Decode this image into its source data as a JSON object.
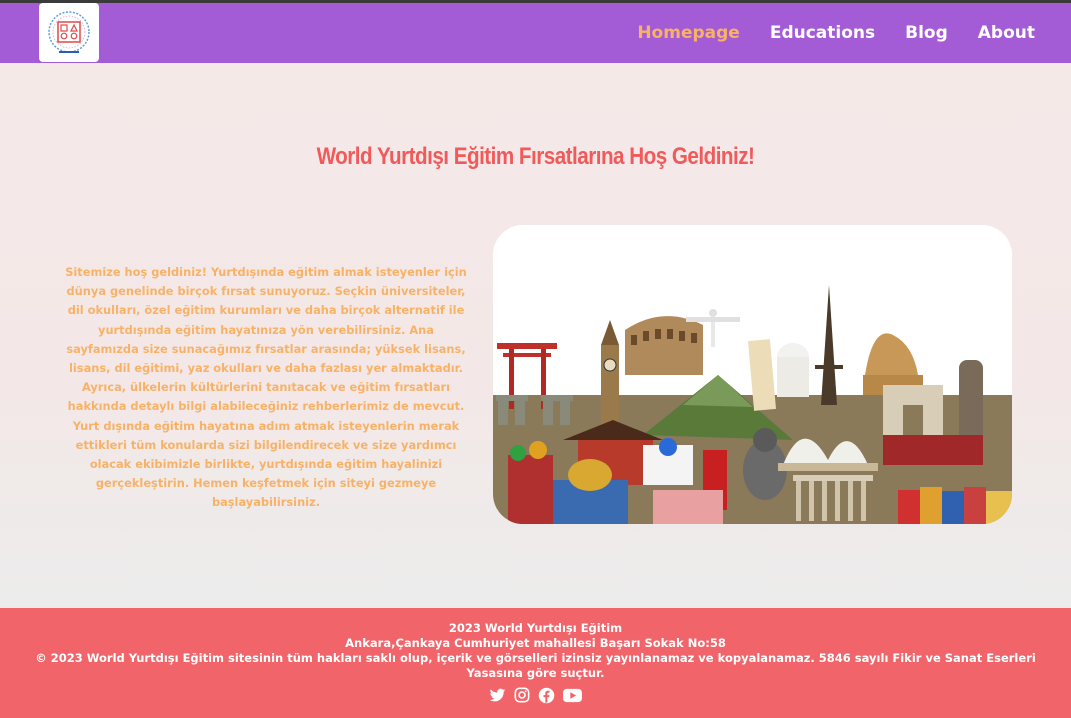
{
  "header": {
    "logo_icon": "school-logo-icon",
    "nav": [
      {
        "label": "Homepage",
        "active": true
      },
      {
        "label": "Educations",
        "active": false
      },
      {
        "label": "Blog",
        "active": false
      },
      {
        "label": "About",
        "active": false
      }
    ]
  },
  "main": {
    "title": "World Yurtdışı Eğitim Fırsatlarına Hoş Geldiniz!",
    "description": "Sitemize hoş geldiniz! Yurtdışında eğitim almak isteyenler için dünya genelinde birçok fırsat sunuyoruz. Seçkin üniversiteler, dil okulları, özel eğitim kurumları ve daha birçok alternatif ile yurtdışında eğitim hayatınıza yön verebilirsiniz. Ana sayfamızda size sunacağımız fırsatlar arasında; yüksek lisans, lisans, dil eğitimi, yaz okulları ve daha fazlası yer almaktadır. Ayrıca, ülkelerin kültürlerini tanıtacak ve eğitim fırsatları hakkında detaylı bilgi alabileceğiniz rehberlerimiz de mevcut. Yurt dışında eğitim hayatına adım atmak isteyenlerin merak ettikleri tüm konularda sizi bilgilendirecek ve size yardımcı olacak ekibimizle birlikte, yurtdışında eğitim hayalinizi gerçekleştirin. Hemen keşfetmek için siteyi gezmeye başlayabilirsiniz.",
    "image_icon": "world-landmarks-collage-image"
  },
  "footer": {
    "line1": "2023 World Yurtdışı Eğitim",
    "address": "Ankara,Çankaya Cumhuriyet mahallesi Başarı Sokak No:58",
    "copyright": "© 2023 World Yurtdışı Eğitim sitesinin tüm hakları saklı olup, içerik ve görselleri izinsiz yayınlanamaz ve kopyalanamaz. 5846 sayılı Fikir ve Sanat Eserleri Yasasına göre suçtur.",
    "social_icons": [
      "twitter-icon",
      "instagram-icon",
      "facebook-icon",
      "youtube-icon"
    ]
  },
  "colors": {
    "navbar": "#a35bd6",
    "active_nav": "#f7b267",
    "title": "#f05a5a",
    "description": "#f7b267",
    "footer": "#f0646a"
  }
}
